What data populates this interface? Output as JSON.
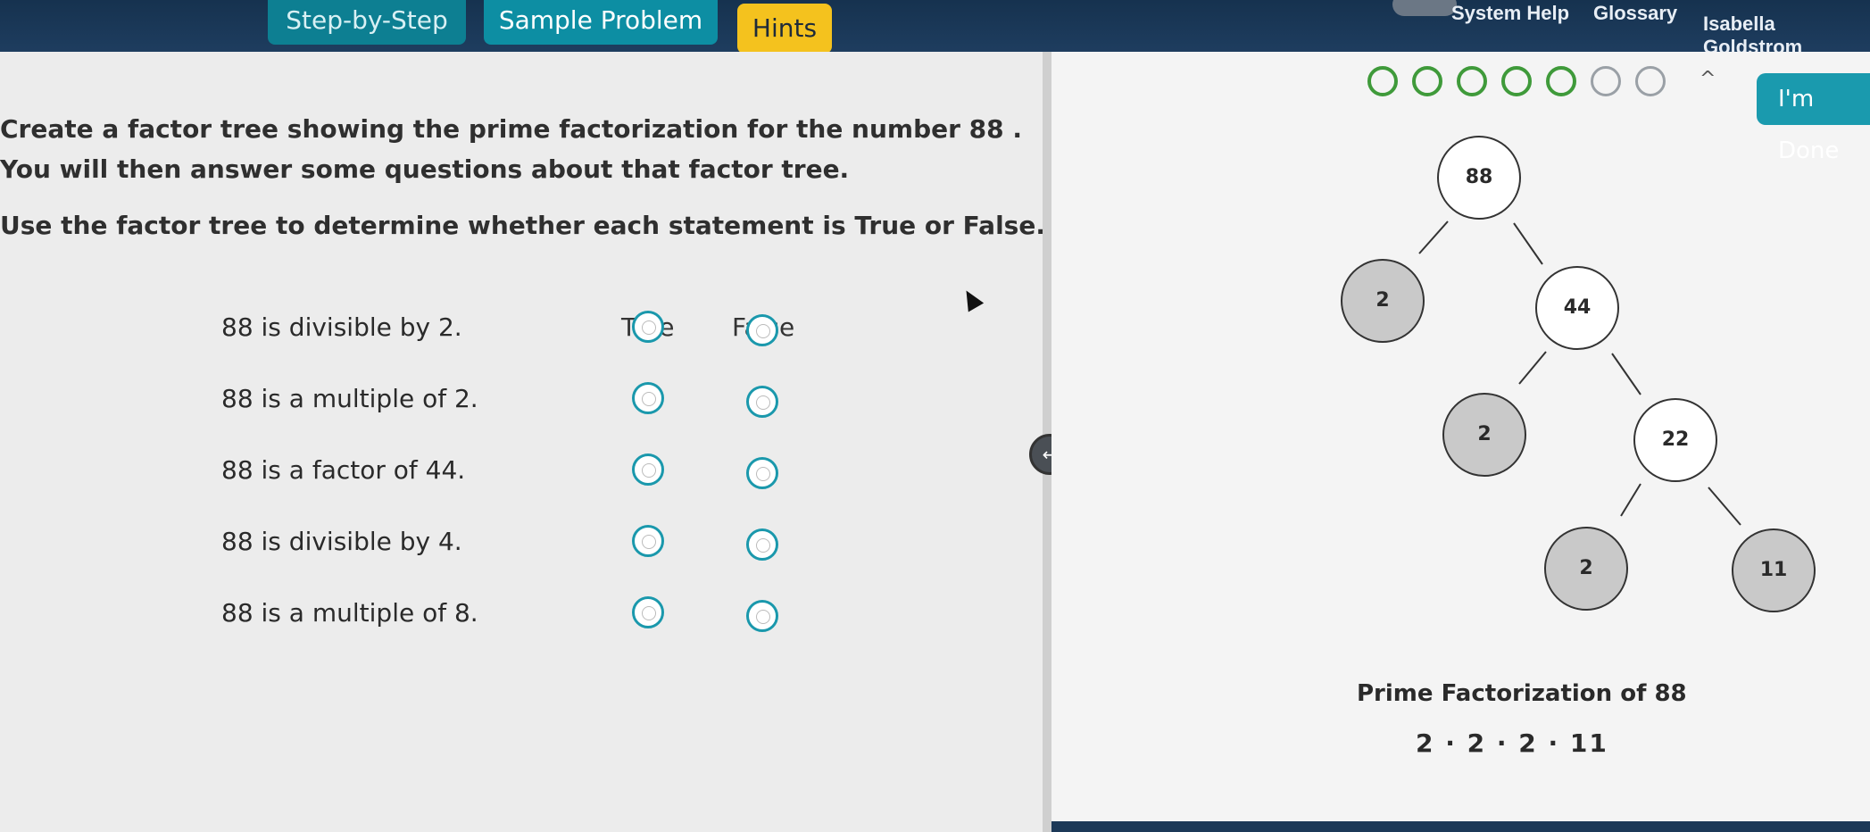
{
  "header": {
    "tabs": [
      {
        "label": "Step-by-Step"
      },
      {
        "label": "Sample Problem"
      },
      {
        "label": "Hints"
      }
    ],
    "links": {
      "help": "System Help",
      "glossary": "Glossary",
      "user": "Isabella Goldstrom"
    }
  },
  "progress": {
    "completed": 5,
    "total": 7,
    "done_label": "I'm Done"
  },
  "instructions": {
    "line1": "Create a factor tree showing the prime factorization for the number 88 .",
    "line2": "You will then answer some questions about that factor tree.",
    "line3": "Use the factor tree to determine whether each statement is True or False."
  },
  "table": {
    "col_true": "True",
    "col_false": "False",
    "rows": [
      {
        "statement": "88 is divisible by 2."
      },
      {
        "statement": "88 is a multiple of 2."
      },
      {
        "statement": "88 is a factor of 44."
      },
      {
        "statement": "88 is divisible by 4."
      },
      {
        "statement": "88 is a multiple of 8."
      }
    ]
  },
  "tree": {
    "n88": "88",
    "n2a": "2",
    "n44": "44",
    "n2b": "2",
    "n22": "22",
    "n2c": "2",
    "n11": "11"
  },
  "prime_factorization": {
    "title": "Prime Factorization of 88",
    "value": "2 · 2 · 2 · 11"
  },
  "colors": {
    "accent": "#1a98ac",
    "hints": "#f4c21e",
    "progress_done": "#3f9a3a"
  }
}
